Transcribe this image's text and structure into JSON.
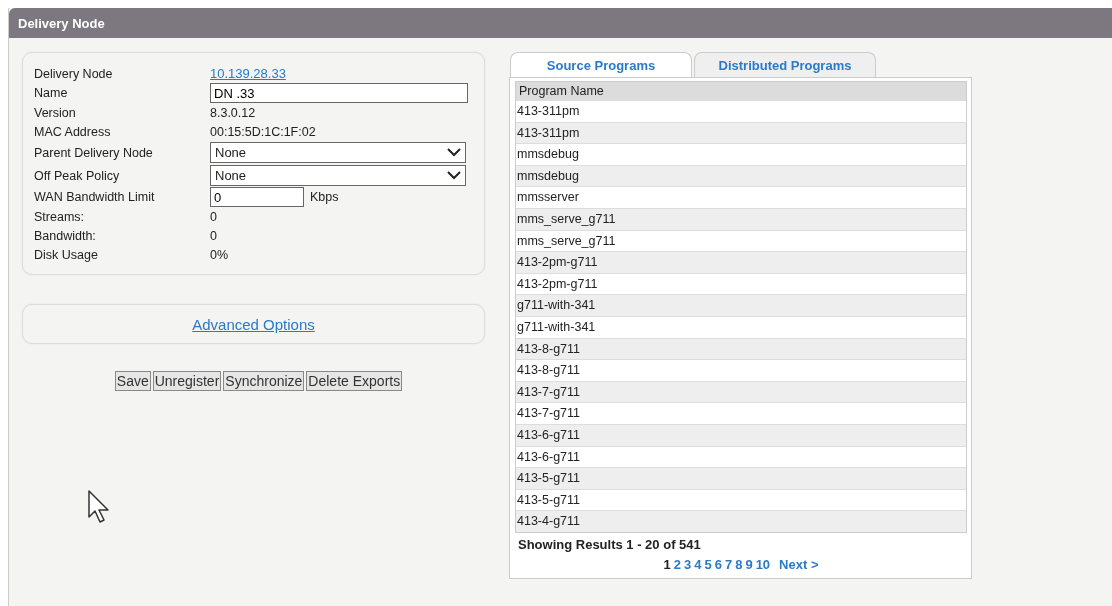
{
  "header": {
    "title": "Delivery Node"
  },
  "details": [
    {
      "kind": "link",
      "label": "Delivery Node",
      "value": "10.139.28.33"
    },
    {
      "kind": "input",
      "label": "Name",
      "value": "DN .33"
    },
    {
      "kind": "text",
      "label": "Version",
      "value": "8.3.0.12"
    },
    {
      "kind": "text",
      "label": "MAC Address",
      "value": "00:15:5D:1C:1F:02"
    },
    {
      "kind": "select",
      "label": "Parent Delivery Node",
      "value": "None"
    },
    {
      "kind": "select",
      "label": "Off Peak Policy",
      "value": "None"
    },
    {
      "kind": "input_unit",
      "label": "WAN Bandwidth Limit",
      "value": "0",
      "unit": "Kbps"
    },
    {
      "kind": "text",
      "label": "Streams:",
      "value": "0"
    },
    {
      "kind": "text",
      "label": "Bandwidth:",
      "value": "0"
    },
    {
      "kind": "text",
      "label": "Disk Usage",
      "value": "0%"
    }
  ],
  "advanced_link": "Advanced Options",
  "buttons": [
    "Save",
    "Unregister",
    "Synchronize",
    "Delete Exports"
  ],
  "tabs": [
    {
      "label": "Source Programs",
      "selected": true
    },
    {
      "label": "Distributed Programs",
      "selected": false
    }
  ],
  "table": {
    "columns": [
      "Program Name"
    ],
    "rows": [
      "413-311pm",
      "413-311pm",
      "mmsdebug",
      "mmsdebug",
      "mmsserver",
      "mms_serve_g711",
      "mms_serve_g711",
      "413-2pm-g711",
      "413-2pm-g711",
      "g711-with-341",
      "g711-with-341",
      "413-8-g711",
      "413-8-g711",
      "413-7-g711",
      "413-7-g711",
      "413-6-g711",
      "413-6-g711",
      "413-5-g711",
      "413-5-g711",
      "413-4-g711"
    ]
  },
  "results_summary": "Showing Results 1 - 20 of 541",
  "pagination": {
    "pages": [
      {
        "label": "1",
        "selected": true
      },
      {
        "label": "2",
        "selected": false
      },
      {
        "label": "3",
        "selected": false
      },
      {
        "label": "4",
        "selected": false
      },
      {
        "label": "5",
        "selected": false
      },
      {
        "label": "6",
        "selected": false
      },
      {
        "label": "7",
        "selected": false
      },
      {
        "label": "8",
        "selected": false
      },
      {
        "label": "9",
        "selected": false
      },
      {
        "label": "10",
        "selected": false
      }
    ],
    "next": "Next >"
  }
}
